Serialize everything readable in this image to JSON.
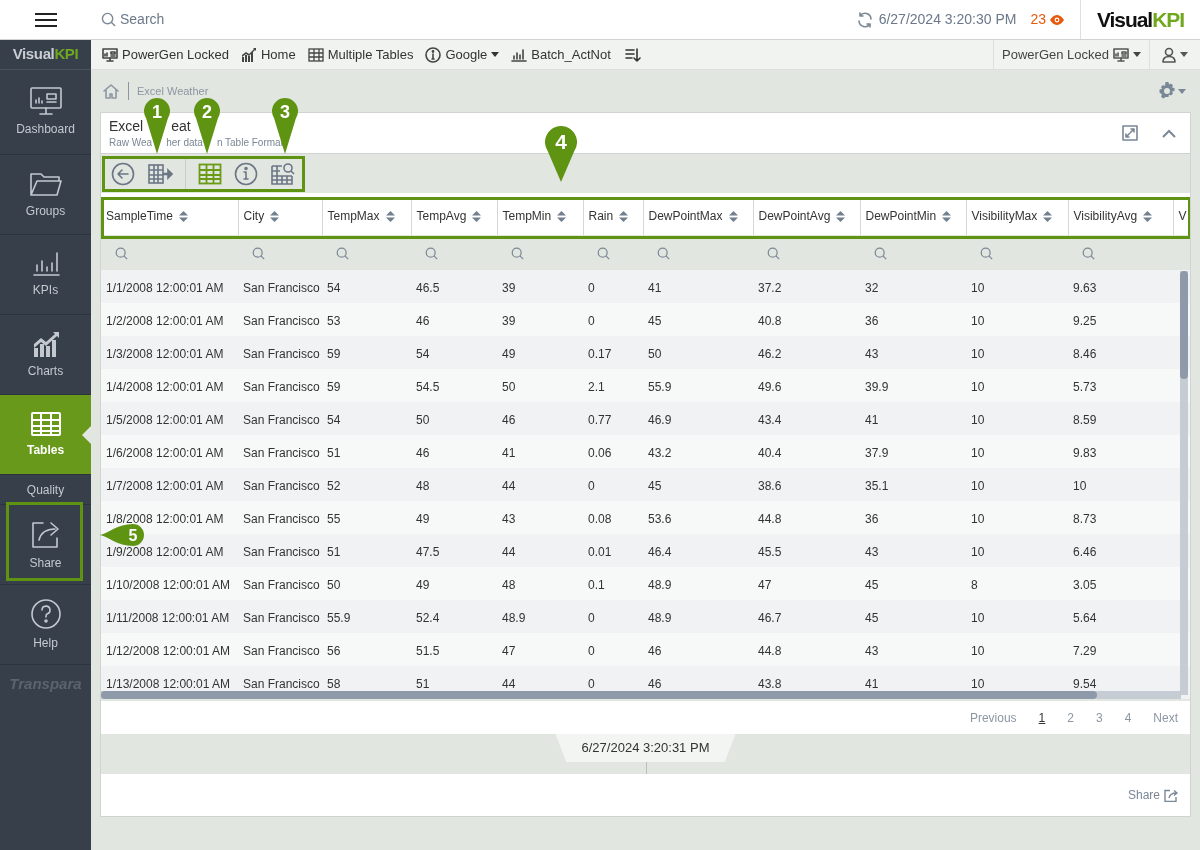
{
  "top_bar": {
    "search": {
      "placeholder": "Search"
    },
    "timestamp": "6/27/2024 3:20:30 PM",
    "alert_count": "23",
    "logo": {
      "main": "Visual",
      "accent": "KPI"
    }
  },
  "sidebar": {
    "logo": {
      "main": "Visual",
      "accent": "KPI"
    },
    "items": [
      {
        "label": "Dashboard",
        "selected": false
      },
      {
        "label": "Groups",
        "selected": false
      },
      {
        "label": "KPIs",
        "selected": false
      },
      {
        "label": "Charts",
        "selected": false
      },
      {
        "label": "Tables",
        "selected": true
      },
      {
        "label": "Quality",
        "selected": false
      },
      {
        "label": "Share",
        "selected": false
      },
      {
        "label": "Help",
        "selected": false
      }
    ],
    "footer_logo": "Transpara"
  },
  "favorites": [
    {
      "label": "PowerGen Locked",
      "dropdown": false
    },
    {
      "label": "Home",
      "dropdown": false
    },
    {
      "label": "Multiple Tables",
      "dropdown": false
    },
    {
      "label": "Google",
      "dropdown": true
    },
    {
      "label": "Batch_ActNot",
      "dropdown": false
    }
  ],
  "profile": {
    "label": "PowerGen Locked"
  },
  "breadcrumb": [
    "Excel Weather"
  ],
  "card": {
    "title": [
      "Excel",
      "eat"
    ],
    "subtitle": [
      "Raw Wea",
      "her data",
      "n Table Format"
    ],
    "toolbar": [
      {
        "active": false
      },
      {
        "active": false
      },
      {
        "active": true
      },
      {
        "active": false
      },
      {
        "active": false
      }
    ],
    "table": {
      "columns": [
        "SampleTime",
        "City",
        "TempMax",
        "TempAvg",
        "TempMin",
        "Rain",
        "DewPointMax",
        "DewPointAvg",
        "DewPointMin",
        "VisibilityMax",
        "VisibilityAvg",
        "V"
      ],
      "rows": [
        [
          "1/1/2008 12:00:01 AM",
          "San Francisco",
          "54",
          "46.5",
          "39",
          "0",
          "41",
          "37.2",
          "32",
          "10",
          "9.63"
        ],
        [
          "1/2/2008 12:00:01 AM",
          "San Francisco",
          "53",
          "46",
          "39",
          "0",
          "45",
          "40.8",
          "36",
          "10",
          "9.25"
        ],
        [
          "1/3/2008 12:00:01 AM",
          "San Francisco",
          "59",
          "54",
          "49",
          "0.17",
          "50",
          "46.2",
          "43",
          "10",
          "8.46"
        ],
        [
          "1/4/2008 12:00:01 AM",
          "San Francisco",
          "59",
          "54.5",
          "50",
          "2.1",
          "55.9",
          "49.6",
          "39.9",
          "10",
          "5.73"
        ],
        [
          "1/5/2008 12:00:01 AM",
          "San Francisco",
          "54",
          "50",
          "46",
          "0.77",
          "46.9",
          "43.4",
          "41",
          "10",
          "8.59"
        ],
        [
          "1/6/2008 12:00:01 AM",
          "San Francisco",
          "51",
          "46",
          "41",
          "0.06",
          "43.2",
          "40.4",
          "37.9",
          "10",
          "9.83"
        ],
        [
          "1/7/2008 12:00:01 AM",
          "San Francisco",
          "52",
          "48",
          "44",
          "0",
          "45",
          "38.6",
          "35.1",
          "10",
          "10"
        ],
        [
          "1/8/2008 12:00:01 AM",
          "San Francisco",
          "55",
          "49",
          "43",
          "0.08",
          "53.6",
          "44.8",
          "36",
          "10",
          "8.73"
        ],
        [
          "1/9/2008 12:00:01 AM",
          "San Francisco",
          "51",
          "47.5",
          "44",
          "0.01",
          "46.4",
          "45.5",
          "43",
          "10",
          "6.46"
        ],
        [
          "1/10/2008 12:00:01 AM",
          "San Francisco",
          "50",
          "49",
          "48",
          "0.1",
          "48.9",
          "47",
          "45",
          "8",
          "3.05"
        ],
        [
          "1/11/2008 12:00:01 AM",
          "San Francisco",
          "55.9",
          "52.4",
          "48.9",
          "0",
          "48.9",
          "46.7",
          "45",
          "10",
          "5.64"
        ],
        [
          "1/12/2008 12:00:01 AM",
          "San Francisco",
          "56",
          "51.5",
          "47",
          "0",
          "46",
          "44.8",
          "43",
          "10",
          "7.29"
        ],
        [
          "1/13/2008 12:00:01 AM",
          "San Francisco",
          "58",
          "51",
          "44",
          "0",
          "46",
          "43.8",
          "41",
          "10",
          "9.54"
        ]
      ]
    },
    "pagination": [
      {
        "label": "Previous",
        "selected": false
      },
      {
        "label": "1",
        "selected": true
      },
      {
        "label": "2",
        "selected": false
      },
      {
        "label": "3",
        "selected": false
      },
      {
        "label": "4",
        "selected": false
      },
      {
        "label": "Next",
        "selected": false
      }
    ],
    "updated": "6/27/2024 3:20:31 PM",
    "share": "Share"
  },
  "callouts": [
    "1",
    "2",
    "3",
    "4",
    "5"
  ]
}
